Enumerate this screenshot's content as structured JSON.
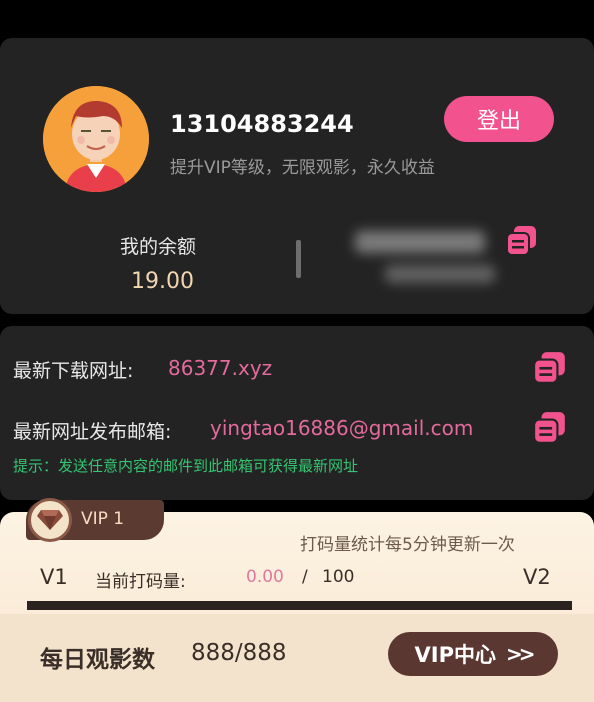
{
  "profile": {
    "phone": "13104883244",
    "tagline": "提升VIP等级，无限观影，永久收益",
    "logout_label": "登出",
    "balance_label": "我的余额",
    "balance_value": "19.00"
  },
  "links": {
    "download_label": "最新下载网址:",
    "download_value": "86377.xyz",
    "email_label": "最新网址发布邮箱:",
    "email_value": "yingtao16886@gmail.com",
    "hint": "提示：发送任意内容的邮件到此邮箱可获得最新网址"
  },
  "vip": {
    "level": "VIP 1",
    "stats_note": "打码量统计每5分钟更新一次",
    "from_level": "V1",
    "to_level": "V2",
    "progress_label": "当前打码量:",
    "progress_current": "0.00",
    "progress_sep": "/",
    "progress_total": "100",
    "progress_fraction": 0.0,
    "daily_label": "每日观影数",
    "daily_value": "888/888",
    "center_button": "VIP中心",
    "center_arrow": ">>"
  },
  "icons": {
    "avatar": "avatar-icon",
    "copy": "copy-icon",
    "gem": "diamond-icon"
  },
  "colors": {
    "accent": "#f2538e",
    "link": "#e36a9b",
    "hint": "#35c572",
    "balance": "#f1d6b0"
  }
}
